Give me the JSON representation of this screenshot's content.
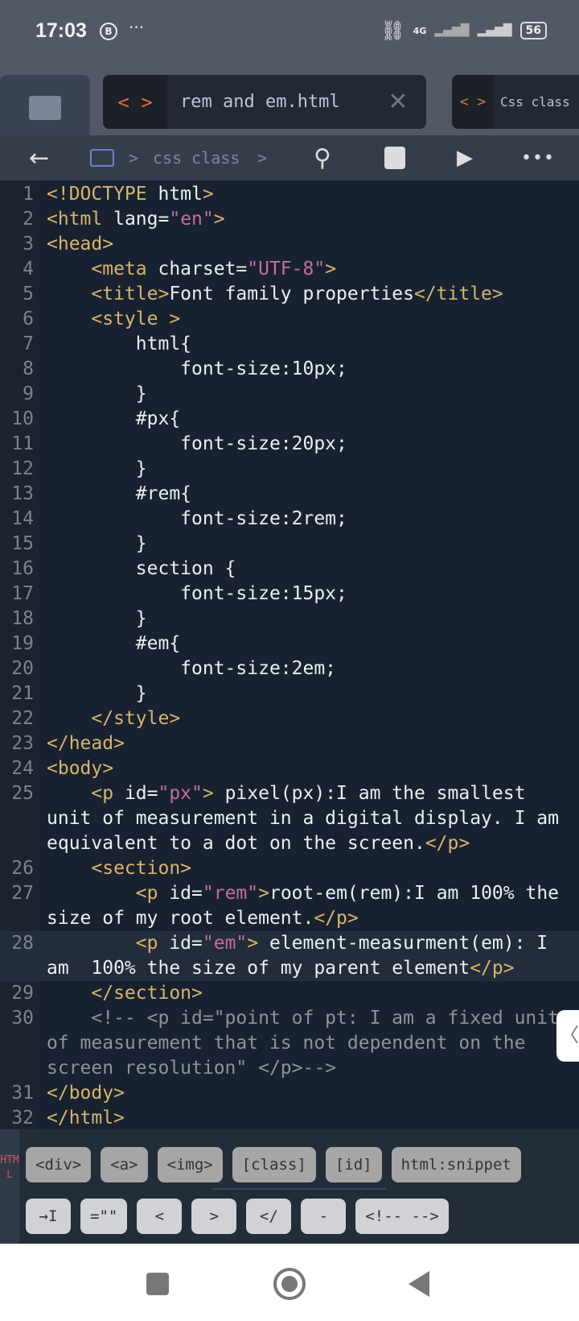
{
  "status_bar": {
    "time": "17:03",
    "notification_badge": "B",
    "more": "···",
    "network": "4G",
    "battery": "56"
  },
  "tabs": [
    {
      "icon": "< >",
      "name": "rem and em.html",
      "close": "✕",
      "active": true
    },
    {
      "icon": "< >",
      "name": "Css class",
      "active": false
    }
  ],
  "toolbar": {
    "breadcrumb": "css class",
    "sep": ">"
  },
  "editor": {
    "active_line": 28,
    "lines": [
      {
        "n": "1",
        "t": [
          [
            "tag",
            "<!DOCTYPE "
          ],
          [
            "txt",
            "html"
          ],
          [
            "tag",
            ">"
          ]
        ]
      },
      {
        "n": "2",
        "t": [
          [
            "tag",
            "<html "
          ],
          [
            "txt",
            "lang="
          ],
          [
            "str",
            "\"en\""
          ],
          [
            "tag",
            ">"
          ]
        ]
      },
      {
        "n": "3",
        "t": [
          [
            "tag",
            "<head>"
          ]
        ]
      },
      {
        "n": "4",
        "t": [
          [
            "txt",
            "    "
          ],
          [
            "tag",
            "<meta "
          ],
          [
            "txt",
            "charset="
          ],
          [
            "str",
            "\"UTF-8\""
          ],
          [
            "tag",
            ">"
          ]
        ]
      },
      {
        "n": "5",
        "t": [
          [
            "txt",
            "    "
          ],
          [
            "tag",
            "<title>"
          ],
          [
            "txt",
            "Font family properties"
          ],
          [
            "tag",
            "</title>"
          ]
        ]
      },
      {
        "n": "6",
        "t": [
          [
            "txt",
            "    "
          ],
          [
            "tag",
            "<style >"
          ]
        ]
      },
      {
        "n": "7",
        "t": [
          [
            "txt",
            "        html{"
          ]
        ]
      },
      {
        "n": "8",
        "t": [
          [
            "txt",
            "            font-size:10px;"
          ]
        ]
      },
      {
        "n": "9",
        "t": [
          [
            "txt",
            "        }"
          ]
        ]
      },
      {
        "n": "10",
        "t": [
          [
            "txt",
            "        #px{"
          ]
        ]
      },
      {
        "n": "11",
        "t": [
          [
            "txt",
            "            font-size:20px;"
          ]
        ]
      },
      {
        "n": "12",
        "t": [
          [
            "txt",
            "        }"
          ]
        ]
      },
      {
        "n": "13",
        "t": [
          [
            "txt",
            "        #rem{"
          ]
        ]
      },
      {
        "n": "14",
        "t": [
          [
            "txt",
            "            font-size:2rem;"
          ]
        ]
      },
      {
        "n": "15",
        "t": [
          [
            "txt",
            "        }"
          ]
        ]
      },
      {
        "n": "16",
        "t": [
          [
            "txt",
            "        section {"
          ]
        ]
      },
      {
        "n": "17",
        "t": [
          [
            "txt",
            "            font-size:15px;"
          ]
        ]
      },
      {
        "n": "18",
        "t": [
          [
            "txt",
            "        }"
          ]
        ]
      },
      {
        "n": "19",
        "t": [
          [
            "txt",
            "        #em{"
          ]
        ]
      },
      {
        "n": "20",
        "t": [
          [
            "txt",
            "            font-size:2em;"
          ]
        ]
      },
      {
        "n": "21",
        "t": [
          [
            "txt",
            "        }"
          ]
        ]
      },
      {
        "n": "22",
        "t": [
          [
            "txt",
            "    "
          ],
          [
            "tag",
            "</style>"
          ]
        ]
      },
      {
        "n": "23",
        "t": [
          [
            "tag",
            "</head>"
          ]
        ]
      },
      {
        "n": "24",
        "t": [
          [
            "tag",
            "<body>"
          ]
        ]
      },
      {
        "n": "25",
        "t": [
          [
            "txt",
            "    "
          ],
          [
            "tag",
            "<p "
          ],
          [
            "txt",
            "id="
          ],
          [
            "str",
            "\"px\""
          ],
          [
            "tag",
            ">"
          ],
          [
            "txt",
            " pixel(px):I am the smallest unit of measurement in a digital display. I am equivalent to a dot on the screen."
          ],
          [
            "tag",
            "</p>"
          ]
        ]
      },
      {
        "n": "26",
        "t": [
          [
            "txt",
            "    "
          ],
          [
            "tag",
            "<section>"
          ]
        ]
      },
      {
        "n": "27",
        "t": [
          [
            "txt",
            "        "
          ],
          [
            "tag",
            "<p "
          ],
          [
            "txt",
            "id="
          ],
          [
            "str",
            "\"rem\""
          ],
          [
            "tag",
            ">"
          ],
          [
            "txt",
            "root-em(rem):I am 100% the size of my root element."
          ],
          [
            "tag",
            "</p>"
          ]
        ]
      },
      {
        "n": "28",
        "t": [
          [
            "txt",
            "        "
          ],
          [
            "tag",
            "<p "
          ],
          [
            "txt",
            "id="
          ],
          [
            "str",
            "\"em\""
          ],
          [
            "tag",
            ">"
          ],
          [
            "txt",
            " element-measurment(em): I am  100% the size of my parent element"
          ],
          [
            "tag",
            "</p>"
          ]
        ]
      },
      {
        "n": "29",
        "t": [
          [
            "txt",
            "    "
          ],
          [
            "tag",
            "</section>"
          ]
        ]
      },
      {
        "n": "30",
        "t": [
          [
            "com",
            "    <!-- <p id=\"point of pt: I am a fixed unit of measurement that is not dependent on the screen resolution\" </p>-->"
          ]
        ]
      },
      {
        "n": "31",
        "t": [
          [
            "tag",
            "</body>"
          ]
        ]
      },
      {
        "n": "32",
        "t": [
          [
            "tag",
            "</html>"
          ]
        ]
      }
    ]
  },
  "keyboard": {
    "side_label": "HTML",
    "row1": [
      "<div>",
      "<a>",
      "<img>",
      "[class]",
      "[id]",
      "html:snippet"
    ],
    "row2": [
      "→I",
      "=\"\"",
      "<",
      ">",
      "</",
      "-",
      "<!-- -->"
    ]
  },
  "colors": {
    "tag": "#d7b56d",
    "string": "#c36f9e",
    "text": "#eceff3",
    "comment": "#8e939b",
    "accent": "#e0703a",
    "background": "#18212f"
  }
}
